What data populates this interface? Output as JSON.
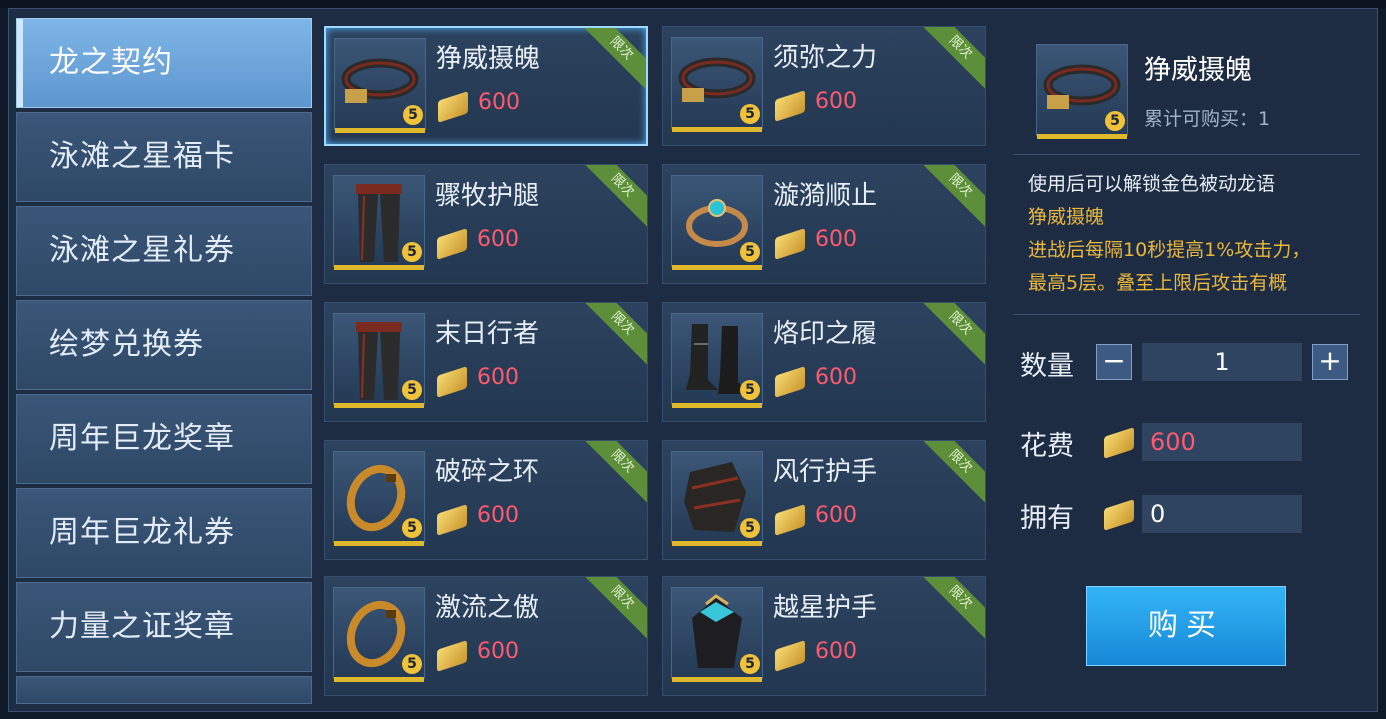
{
  "sidebar": {
    "items": [
      {
        "label": "龙之契约",
        "active": true
      },
      {
        "label": "泳滩之星福卡"
      },
      {
        "label": "泳滩之星礼券"
      },
      {
        "label": "绘梦兑换券"
      },
      {
        "label": "周年巨龙奖章"
      },
      {
        "label": "周年巨龙礼券"
      },
      {
        "label": "力量之证奖章"
      }
    ]
  },
  "items": [
    {
      "name": "狰威摄魄",
      "price": "600",
      "badge": "限次",
      "level": "5",
      "icon": "belt-icon"
    },
    {
      "name": "须弥之力",
      "price": "600",
      "badge": "限次",
      "level": "5",
      "icon": "belt-icon"
    },
    {
      "name": "骤牧护腿",
      "price": "600",
      "badge": "限次",
      "level": "5",
      "icon": "leggings-icon"
    },
    {
      "name": "漩漪顺止",
      "price": "600",
      "badge": "限次",
      "level": "5",
      "icon": "ring-icon"
    },
    {
      "name": "末日行者",
      "price": "600",
      "badge": "限次",
      "level": "5",
      "icon": "leggings-icon"
    },
    {
      "name": "烙印之履",
      "price": "600",
      "badge": "限次",
      "level": "5",
      "icon": "boots-icon"
    },
    {
      "name": "破碎之环",
      "price": "600",
      "badge": "限次",
      "level": "5",
      "icon": "ring-icon"
    },
    {
      "name": "风行护手",
      "price": "600",
      "badge": "限次",
      "level": "5",
      "icon": "gauntlet-icon"
    },
    {
      "name": "激流之傲",
      "price": "600",
      "badge": "限次",
      "level": "5",
      "icon": "ring-icon"
    },
    {
      "name": "越星护手",
      "price": "600",
      "badge": "限次",
      "level": "5",
      "icon": "gauntlet-icon"
    }
  ],
  "detail": {
    "name": "狰威摄魄",
    "limit": "累计可购买：1",
    "level": "5",
    "desc_line1": "使用后可以解锁金色被动龙语",
    "desc_name": "狰威摄魄",
    "desc_line2": "进战后每隔10秒提高1%攻击力，",
    "desc_line3": "最高5层。叠至上限后攻击有概",
    "qty_label": "数量",
    "qty_value": "1",
    "minus": "−",
    "plus": "+",
    "cost_label": "花费",
    "cost_value": "600",
    "own_label": "拥有",
    "own_value": "0",
    "buy_label": "购买"
  },
  "colors": {
    "price": "#ff5a6e",
    "accent_yellow": "#e9b73c",
    "buy_button": "#1f9ae8"
  }
}
